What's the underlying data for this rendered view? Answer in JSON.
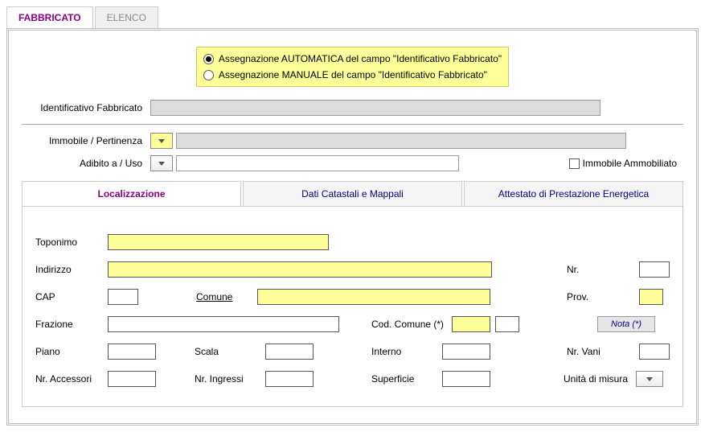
{
  "topTabs": {
    "fabbricato": "FABBRICATO",
    "elenco": "ELENCO"
  },
  "radio": {
    "auto": "Assegnazione AUTOMATICA del campo \"Identificativo Fabbricato\"",
    "manual": "Assegnazione MANUALE del campo \"Identificativo Fabbricato\""
  },
  "labels": {
    "identFabbricato": "Identificativo Fabbricato",
    "immobilePert": "Immobile / Pertinenza",
    "adibito": "Adibito a / Uso",
    "immobileAmm": "Immobile Ammobiliato"
  },
  "subTabs": {
    "loc": "Localizzazione",
    "cat": "Dati Catastali e Mappali",
    "att": "Attestato di Prestazione Energetica"
  },
  "loc": {
    "toponimo": "Toponimo",
    "indirizzo": "Indirizzo",
    "nr": "Nr.",
    "cap": "CAP",
    "comune": "Comune",
    "prov": "Prov.",
    "frazione": "Frazione",
    "codComune": "Cod. Comune (*)",
    "nota": "Nota (*)",
    "piano": "Piano",
    "scala": "Scala",
    "interno": "Interno",
    "nrVani": "Nr. Vani",
    "nrAccessori": "Nr. Accessori",
    "nrIngressi": "Nr. Ingressi",
    "superficie": "Superficie",
    "unitaMisura": "Unità di misura"
  }
}
